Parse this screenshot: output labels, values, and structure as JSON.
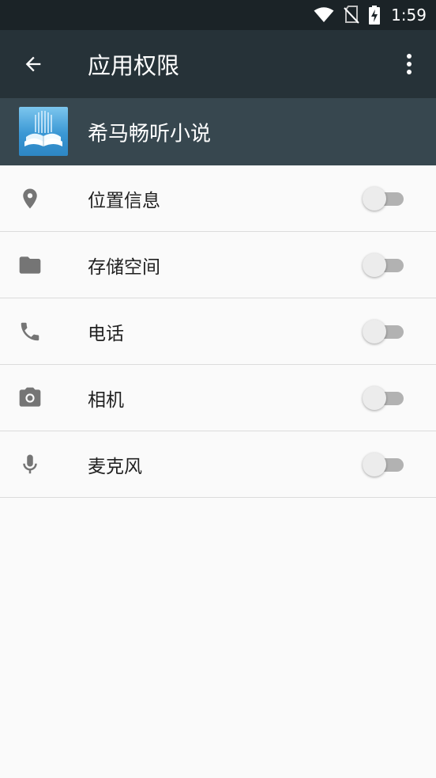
{
  "status_bar": {
    "time": "1:59",
    "icons": [
      "wifi-icon",
      "no-sim-icon",
      "battery-charging-icon"
    ]
  },
  "app_bar": {
    "title": "应用权限",
    "back_icon": "arrow-back-icon",
    "more_icon": "more-vert-icon"
  },
  "app": {
    "name": "希马畅听小说",
    "icon": "book-app-icon"
  },
  "permissions": [
    {
      "label": "位置信息",
      "icon": "location-pin-icon",
      "enabled": false
    },
    {
      "label": "存储空间",
      "icon": "folder-icon",
      "enabled": false
    },
    {
      "label": "电话",
      "icon": "phone-icon",
      "enabled": false
    },
    {
      "label": "相机",
      "icon": "camera-icon",
      "enabled": false
    },
    {
      "label": "麦克风",
      "icon": "microphone-icon",
      "enabled": false
    }
  ],
  "colors": {
    "status_bar": "#1b2327",
    "app_bar": "#263238",
    "app_header": "#37474f",
    "background": "#fafafa",
    "icon_gray": "#757575"
  }
}
